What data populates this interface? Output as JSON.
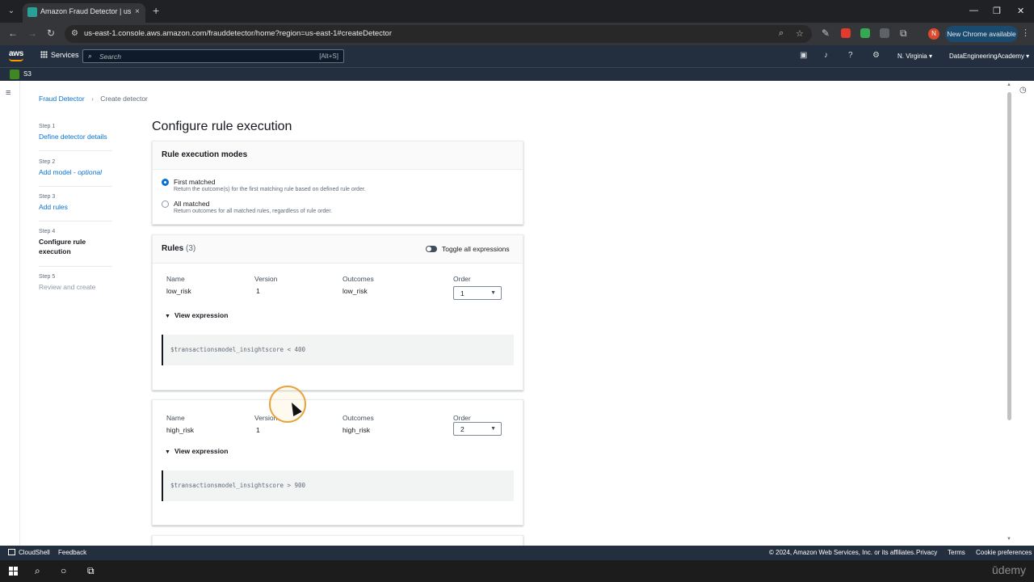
{
  "browser": {
    "tab_title": "Amazon Fraud Detector | us-east-1",
    "tab_close": "×",
    "new_tab": "+",
    "url": "us-east-1.console.aws.amazon.com/frauddetector/home?region=us-east-1#createDetector",
    "new_chrome_label": "New Chrome available",
    "profile_initial": "N",
    "icons": [
      "back-icon",
      "forward-icon",
      "reload-icon",
      "zoom-icon",
      "star-icon",
      "extension-icons",
      "menu-icon"
    ]
  },
  "aws_nav": {
    "logo": "aws",
    "services_label": "Services",
    "search_placeholder": "Search",
    "search_shortcut": "[Alt+S]",
    "region": "N. Virginia ▾",
    "account": "DataEngineeringAcademy ▾"
  },
  "favorites": {
    "s3_label": "S3"
  },
  "breadcrumb": {
    "root": "Fraud Detector",
    "current": "Create detector"
  },
  "steps": [
    {
      "num": "Step 1",
      "label": "Define detector details",
      "state": "link"
    },
    {
      "num": "Step 2",
      "label": "Add model - ",
      "label_optional": "optional",
      "state": "link"
    },
    {
      "num": "Step 3",
      "label": "Add rules",
      "state": "link"
    },
    {
      "num": "Step 4",
      "label": "Configure rule execution",
      "state": "current"
    },
    {
      "num": "Step 5",
      "label": "Review and create",
      "state": "disabled"
    }
  ],
  "page_title": "Configure rule execution",
  "modes_panel": {
    "title": "Rule execution modes",
    "options": [
      {
        "label": "First matched",
        "desc": "Return the outcome(s) for the first matching rule based on defined rule order.",
        "selected": true
      },
      {
        "label": "All matched",
        "desc": "Return outcomes for all matched rules, regardless of rule order.",
        "selected": false
      }
    ]
  },
  "rules_panel": {
    "title": "Rules",
    "count": "(3)",
    "toggle_label": "Toggle all expressions",
    "columns": {
      "name": "Name",
      "version": "Version",
      "outcomes": "Outcomes",
      "order": "Order"
    },
    "expander_label": "View expression",
    "rules": [
      {
        "name": "low_risk",
        "version": "1",
        "outcomes": "low_risk",
        "order": "1",
        "expression": "$transactionsmodel_insightscore < 400"
      },
      {
        "name": "high_risk",
        "version": "1",
        "outcomes": "high_risk",
        "order": "2",
        "expression": "$transactionsmodel_insightscore > 900"
      }
    ]
  },
  "footer": {
    "cloudshell": "CloudShell",
    "feedback": "Feedback",
    "copyright": "© 2024, Amazon Web Services, Inc. or its affiliates.",
    "privacy": "Privacy",
    "terms": "Terms",
    "cookie": "Cookie preferences"
  },
  "watermark": "ūdemy",
  "colors": {
    "accent": "#0972d3",
    "aws_nav": "#232f3e",
    "aws_orange": "#ff9900"
  }
}
